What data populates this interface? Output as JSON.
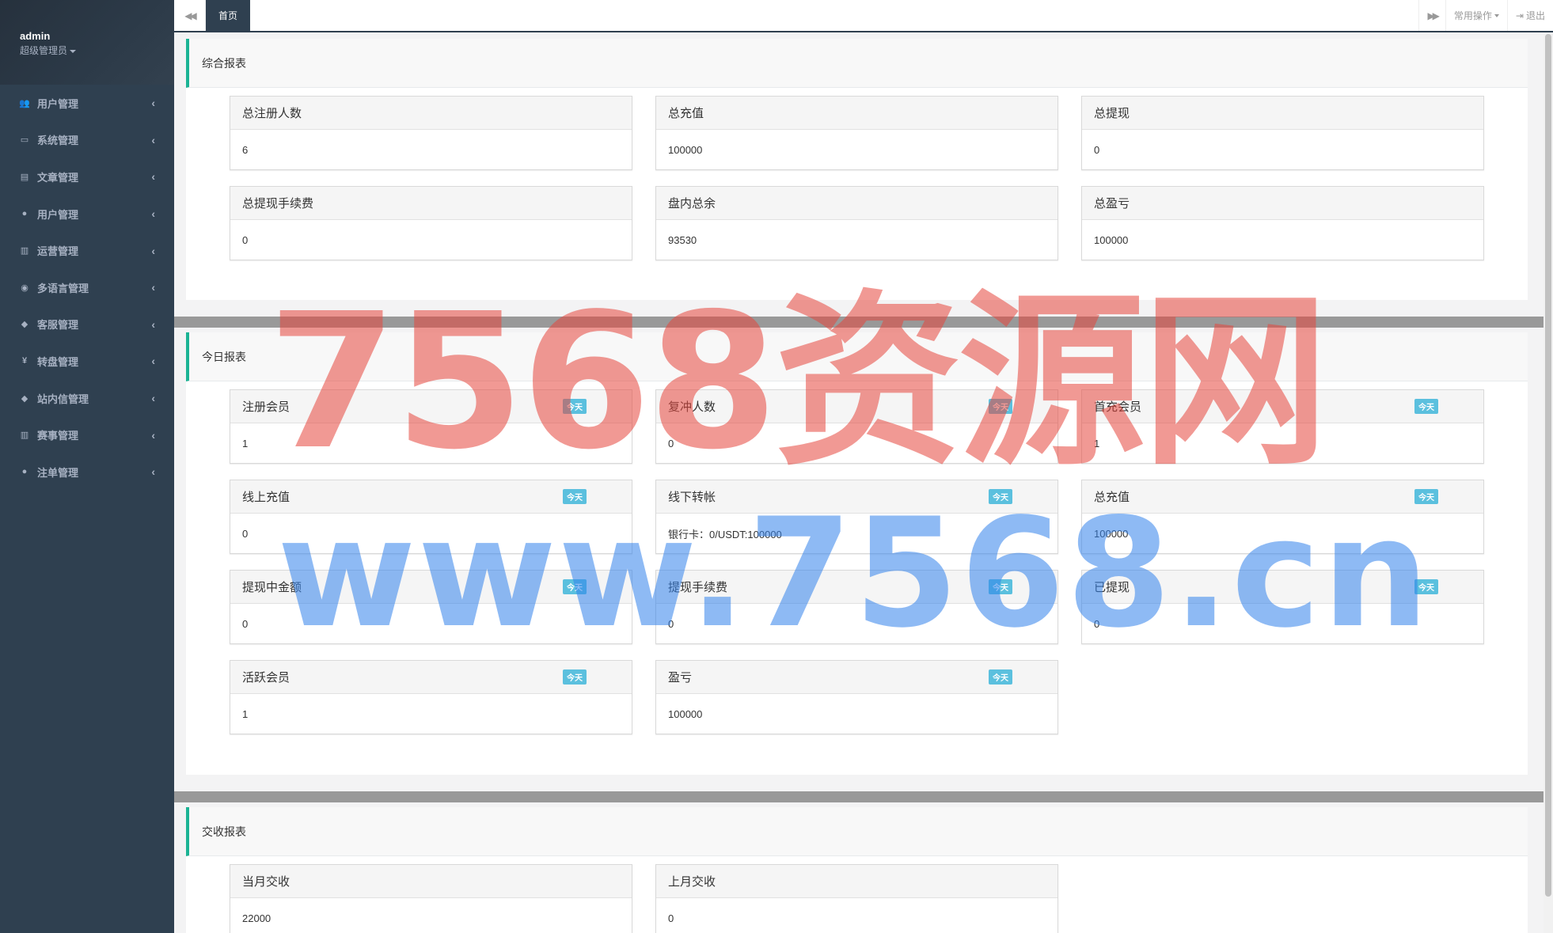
{
  "sidebar": {
    "username": "admin",
    "role": "超级管理员",
    "items": [
      {
        "label": "用户管理",
        "icon": "users-icon"
      },
      {
        "label": "系统管理",
        "icon": "desktop-icon"
      },
      {
        "label": "文章管理",
        "icon": "book-icon"
      },
      {
        "label": "用户管理",
        "icon": "user-icon"
      },
      {
        "label": "运营管理",
        "icon": "bar-chart-icon"
      },
      {
        "label": "多语言管理",
        "icon": "globe-icon"
      },
      {
        "label": "客服管理",
        "icon": "comment-icon"
      },
      {
        "label": "转盘管理",
        "icon": "yen-icon"
      },
      {
        "label": "站内信管理",
        "icon": "comment-icon"
      },
      {
        "label": "赛事管理",
        "icon": "bar-chart-icon"
      },
      {
        "label": "注单管理",
        "icon": "user-icon"
      }
    ]
  },
  "topbar": {
    "home_tab": "首页",
    "common_ops": "常用操作",
    "logout": "退出"
  },
  "summary": {
    "title": "综合报表",
    "cards": [
      {
        "label": "总注册人数",
        "value": "6"
      },
      {
        "label": "总充值",
        "value": "100000"
      },
      {
        "label": "总提现",
        "value": "0"
      },
      {
        "label": "总提现手续费",
        "value": "0"
      },
      {
        "label": "盘内总余",
        "value": "93530"
      },
      {
        "label": "总盈亏",
        "value": "100000"
      }
    ]
  },
  "today": {
    "title": "今日报表",
    "badge": "今天",
    "cards": [
      {
        "label": "注册会员",
        "value": "1"
      },
      {
        "label": "复冲人数",
        "value": "0"
      },
      {
        "label": "首充会员",
        "value": "1"
      },
      {
        "label": "线上充值",
        "value": "0"
      },
      {
        "label": "线下转帐",
        "value": "银行卡：0/USDT:100000"
      },
      {
        "label": "总充值",
        "value": "100000"
      },
      {
        "label": "提现中金额",
        "value": "0"
      },
      {
        "label": "提现手续费",
        "value": "0"
      },
      {
        "label": "已提现",
        "value": "0"
      },
      {
        "label": "活跃会员",
        "value": "1"
      },
      {
        "label": "盈亏",
        "value": "100000"
      }
    ]
  },
  "settlement": {
    "title": "交收报表",
    "cards": [
      {
        "label": "当月交收",
        "value": "22000"
      },
      {
        "label": "上月交收",
        "value": "0"
      }
    ]
  },
  "watermark": {
    "line1": "7568资源网",
    "line2": "www.7568.cn"
  },
  "colors": {
    "sidebar_bg": "#2f4050",
    "accent": "#1ab394",
    "badge": "#5bc0de"
  }
}
